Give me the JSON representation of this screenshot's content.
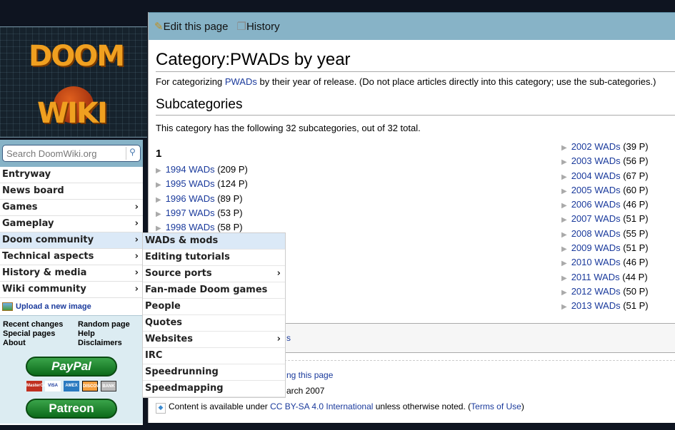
{
  "logo": {
    "text_top": "DOOM",
    "text_bottom": "WIKI"
  },
  "search": {
    "placeholder": "Search DoomWiki.org",
    "icon": "magnifier-icon"
  },
  "sidebar": {
    "items": [
      {
        "label": "Entryway",
        "sub": false
      },
      {
        "label": "News board",
        "sub": false
      },
      {
        "label": "Games",
        "sub": true
      },
      {
        "label": "Gameplay",
        "sub": true
      },
      {
        "label": "Doom community",
        "sub": true,
        "active": true
      },
      {
        "label": "Technical aspects",
        "sub": true
      },
      {
        "label": "History & media",
        "sub": true
      },
      {
        "label": "Wiki community",
        "sub": true
      }
    ],
    "upload": "Upload a new image",
    "tools": [
      "Recent changes",
      "Random page",
      "Special pages",
      "Help",
      "About",
      "Disclaimers"
    ],
    "paypal": "PayPal",
    "cards": [
      "MasterCard",
      "VISA",
      "AMEX",
      "DISCOVER",
      "BANK"
    ],
    "patreon": "Patreon"
  },
  "submenu": [
    {
      "label": "WADs & mods",
      "active": true
    },
    {
      "label": "Editing tutorials"
    },
    {
      "label": "Source ports",
      "sub": true
    },
    {
      "label": "Fan-made Doom games"
    },
    {
      "label": "People"
    },
    {
      "label": "Quotes"
    },
    {
      "label": "Websites",
      "sub": true
    },
    {
      "label": "IRC"
    },
    {
      "label": "Speedrunning"
    },
    {
      "label": "Speedmapping"
    }
  ],
  "toolbar": {
    "edit": "Edit this page",
    "history": "History"
  },
  "page": {
    "title": "Category:PWADs by year",
    "intro_pre": "For categorizing ",
    "intro_link": "PWADs",
    "intro_post": " by their year of release. (Do not place articles directly into this category; use the sub-categories.)",
    "subheading": "Subcategories",
    "count": "This category has the following 32 subcategories, out of 32 total.",
    "group": "1",
    "left": [
      [
        "1994 WADs",
        "(209 P)"
      ],
      [
        "1995 WADs",
        "(124 P)"
      ],
      [
        "1996 WADs",
        "(89 P)"
      ],
      [
        "1997 WADs",
        "(53 P)"
      ],
      [
        "1998 WADs",
        "(58 P)"
      ]
    ],
    "right": [
      [
        "2002 WADs",
        "(39 P)"
      ],
      [
        "2003 WADs",
        "(56 P)"
      ],
      [
        "2004 WADs",
        "(67 P)"
      ],
      [
        "2005 WADs",
        "(60 P)"
      ],
      [
        "2006 WADs",
        "(46 P)"
      ],
      [
        "2007 WADs",
        "(51 P)"
      ],
      [
        "2008 WADs",
        "(55 P)"
      ],
      [
        "2009 WADs",
        "(51 P)"
      ],
      [
        "2010 WADs",
        "(46 P)"
      ],
      [
        "2011 WADs",
        "(44 P)"
      ],
      [
        "2012 WADs",
        "(50 P)"
      ],
      [
        "2013 WADs",
        "(51 P)"
      ]
    ]
  },
  "footer": {
    "frag1": "s",
    "frag2": "ng this page",
    "frag3": "arch 2007",
    "license_pre": "Content is available under ",
    "license_link": "CC BY-SA 4.0 International",
    "license_mid": " unless otherwise noted. (",
    "terms": "Terms of Use",
    "license_post": ")"
  },
  "colors": {
    "background": "#0e1420",
    "header_bar": "#87b3c7",
    "link": "#1a3a9c",
    "active_item": "#dbe9f7"
  }
}
